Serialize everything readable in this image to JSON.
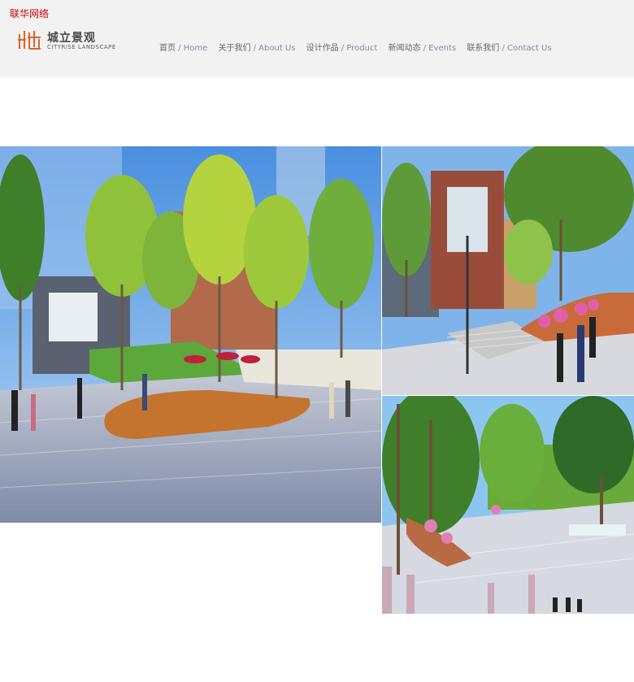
{
  "site_tag": "联华网络",
  "brand": {
    "name_cn": "城立景观",
    "name_en": "CITYRISE LANDSCAPE",
    "accent": "#e2612b"
  },
  "nav": [
    {
      "cn": "首页",
      "en": " / Home"
    },
    {
      "cn": "关于我们",
      "en": " / About Us"
    },
    {
      "cn": "设计作品",
      "en": " / Product"
    },
    {
      "cn": "新闻动态",
      "en": " / Events"
    },
    {
      "cn": "联系我们",
      "en": " / Contact Us"
    }
  ]
}
